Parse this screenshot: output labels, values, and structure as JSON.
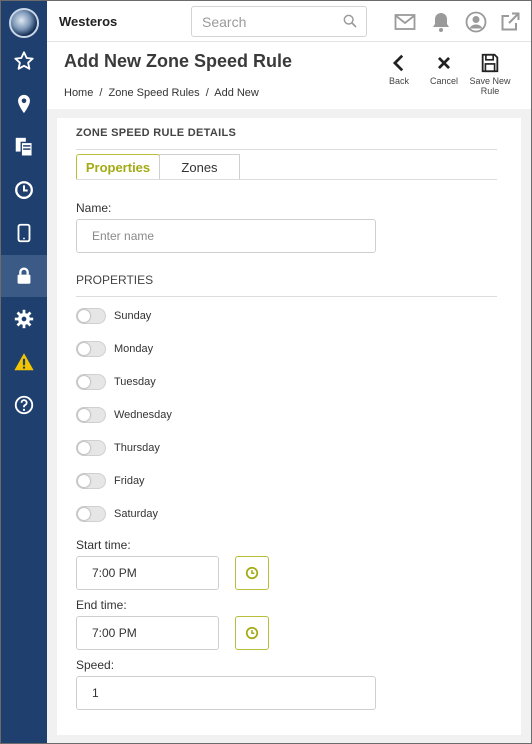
{
  "app": {
    "title": "Westeros"
  },
  "search": {
    "placeholder": "Search"
  },
  "sidebar": {
    "items": [
      {
        "name": "favorites",
        "icon": "star-icon"
      },
      {
        "name": "location",
        "icon": "map-pin-icon"
      },
      {
        "name": "documents",
        "icon": "documents-icon"
      },
      {
        "name": "history",
        "icon": "clock-icon"
      },
      {
        "name": "devices",
        "icon": "tablet-icon"
      },
      {
        "name": "security",
        "icon": "lock-icon",
        "active": true
      },
      {
        "name": "settings",
        "icon": "gear-icon"
      },
      {
        "name": "alerts",
        "icon": "warning-icon"
      },
      {
        "name": "help",
        "icon": "help-icon"
      }
    ]
  },
  "header_icons": [
    "mail-icon",
    "bell-icon",
    "user-icon",
    "external-link-icon"
  ],
  "page": {
    "title": "Add New Zone Speed Rule",
    "breadcrumbs": [
      "Home",
      "/",
      "Zone Speed Rules",
      "/",
      "Add New"
    ]
  },
  "actions": {
    "back": "Back",
    "cancel": "Cancel",
    "save_line1": "Save New",
    "save_line2": "Rule"
  },
  "form": {
    "section_title": "ZONE SPEED RULE DETAILS",
    "tabs": [
      "Properties",
      "Zones"
    ],
    "name_label": "Name:",
    "name_placeholder": "Enter name",
    "properties_title": "PROPERTIES",
    "days": [
      "Sunday",
      "Monday",
      "Tuesday",
      "Wednesday",
      "Thursday",
      "Friday",
      "Saturday"
    ],
    "start_label": "Start time:",
    "start_value": "7:00 PM",
    "end_label": "End time:",
    "end_value": "7:00 PM",
    "speed_label": "Speed:",
    "speed_value": "1"
  },
  "colors": {
    "sidebar": "#1f3f6e",
    "sidebar_active": "#3b5a86",
    "accent": "#a3ab14",
    "warning": "#f2c500"
  }
}
